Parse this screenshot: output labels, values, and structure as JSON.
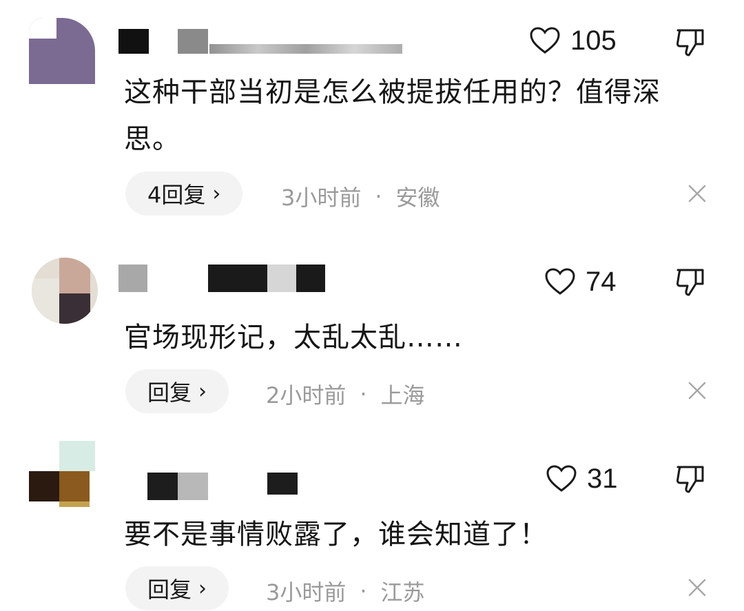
{
  "comments": [
    {
      "likes": "105",
      "text": "这种干部当初是怎么被提拔任用的？值得深思。",
      "reply_label": "4回复",
      "reply_chevron": "›",
      "time": "3小时前",
      "separator": "·",
      "location": "安徽"
    },
    {
      "likes": "74",
      "text": "官场现形记，太乱太乱……",
      "reply_label": "回复",
      "reply_chevron": "›",
      "time": "2小时前",
      "separator": "·",
      "location": "上海"
    },
    {
      "likes": "31",
      "text": "要不是事情败露了，谁会知道了！",
      "reply_label": "回复",
      "reply_chevron": "›",
      "time": "3小时前",
      "separator": "·",
      "location": "江苏"
    }
  ],
  "icons": {
    "like": "heart-outline-icon",
    "dislike": "thumbs-down-icon",
    "dismiss": "close-icon"
  },
  "colors": {
    "text": "#161616",
    "meta": "#9a9a9a",
    "reply_bg": "#f3f3f3",
    "icon": "#1a1a1a"
  }
}
